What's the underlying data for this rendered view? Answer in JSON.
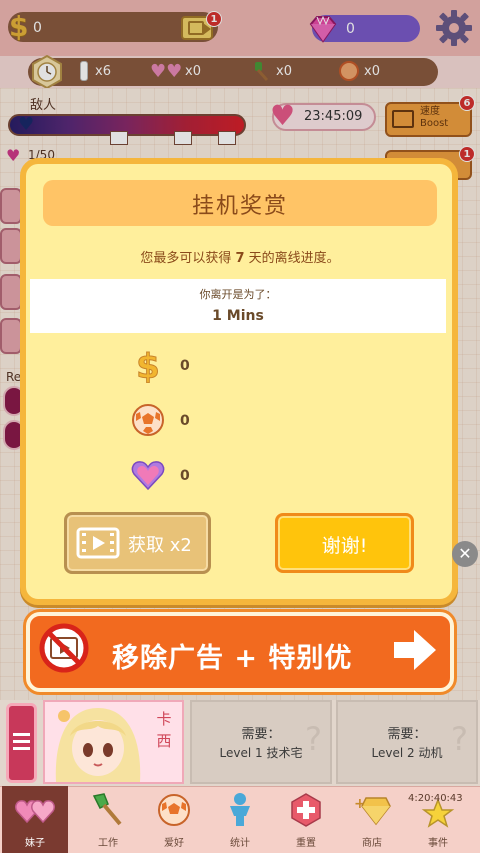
{
  "hud": {
    "money_symbol": "$",
    "money_value": "0",
    "video_badge": "1",
    "gem_value": "0"
  },
  "inventory": {
    "item1": "x6",
    "item2": "x0",
    "item3": "x0",
    "item4": "x0"
  },
  "game": {
    "enemy_label": "敌人",
    "timer": "23:45:09",
    "boost_label_line1": "速度",
    "boost_label_line2": "Boost",
    "boost_badge": "6",
    "boost2_badge": "1",
    "love_count": "1/50",
    "side_label": "Re"
  },
  "modal": {
    "title": "挂机奖赏",
    "sub_prefix": "您最多可以获得",
    "sub_days": "7",
    "sub_suffix": "天的离线进度。",
    "away_label": "你离开是为了：",
    "away_value": "1 Mins",
    "rewards": [
      {
        "icon": "dollar-icon",
        "value": "0"
      },
      {
        "icon": "ball-icon",
        "value": "0"
      },
      {
        "icon": "heart-icon",
        "value": "0"
      }
    ],
    "double_button": "获取 x2",
    "thanks_button": "谢谢!"
  },
  "banner": {
    "text": "移除广告 + 特别优"
  },
  "bottom": {
    "character_name": "卡西",
    "slots": [
      {
        "need": "需要：",
        "req": "Level 1 技术宅"
      },
      {
        "need": "需要：",
        "req": "Level 2 动机"
      }
    ],
    "clock": "4:20:40:43"
  },
  "nav": [
    {
      "label": "妹子",
      "icon": "hearts-icon",
      "active": true
    },
    {
      "label": "工作",
      "icon": "shovel-icon",
      "active": false
    },
    {
      "label": "爱好",
      "icon": "ball-icon",
      "active": false
    },
    {
      "label": "统计",
      "icon": "person-icon",
      "active": false
    },
    {
      "label": "重置",
      "icon": "reset-icon",
      "active": false
    },
    {
      "label": "商店",
      "icon": "shop-icon",
      "active": false
    },
    {
      "label": "事件",
      "icon": "star-icon",
      "active": false
    }
  ],
  "colors": {
    "modal_bg": "#ffef9c",
    "modal_border": "#f5b63c",
    "banner_bg": "#f26a1f",
    "thanks_bg": "#ffc40c",
    "gem_pill": "#7a5bc9",
    "money_pill": "#8a5a3f"
  }
}
